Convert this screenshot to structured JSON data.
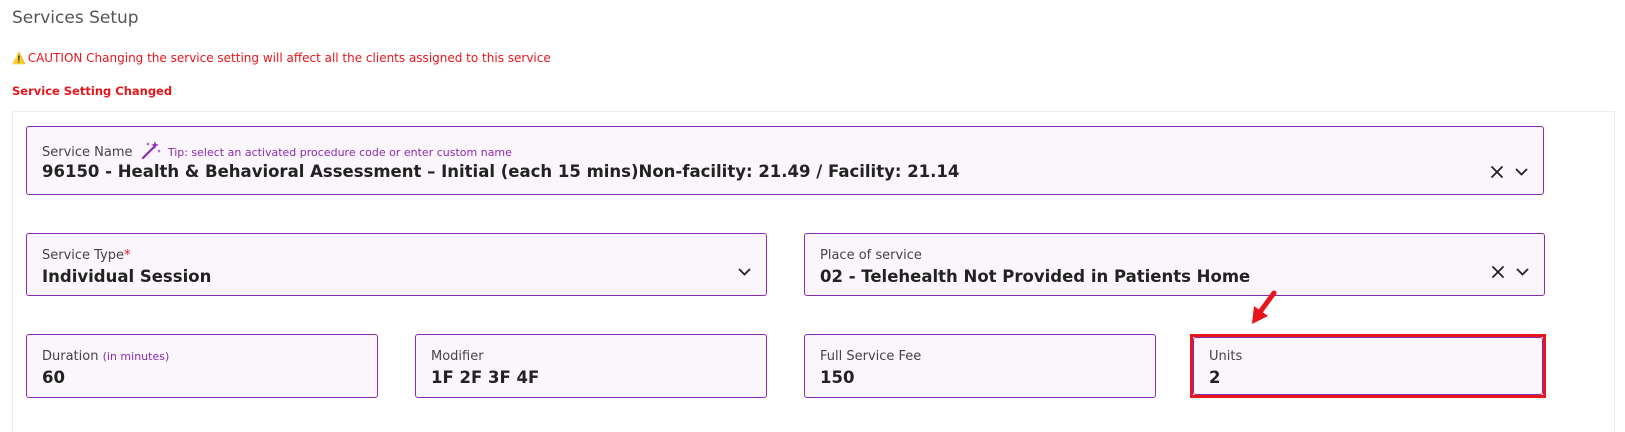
{
  "page": {
    "title": "Services Setup",
    "caution_text": "CAUTION Changing the service setting will affect all the clients assigned to this service",
    "changed_text": "Service Setting Changed"
  },
  "service_name": {
    "label": "Service Name",
    "tip": "Tip: select an activated procedure code or enter custom name",
    "value": "96150 - Health & Behavioral Assessment – Initial (each 15 mins)Non-facility: 21.49 / Facility: 21.14"
  },
  "service_type": {
    "label": "Service Type",
    "required_mark": "*",
    "value": "Individual Session"
  },
  "place_of_service": {
    "label": "Place of service",
    "value": "02 - Telehealth Not Provided in Patients Home"
  },
  "duration": {
    "label": "Duration",
    "hint": "(in minutes)",
    "value": "60"
  },
  "modifier": {
    "label": "Modifier",
    "value": "1F 2F 3F 4F"
  },
  "fee": {
    "label": "Full Service Fee",
    "value": "150"
  },
  "units": {
    "label": "Units",
    "value": "2"
  },
  "colors": {
    "accent": "#8b2bb3",
    "danger": "#e8161b",
    "field_bg": "#faf6fb"
  },
  "icons": {
    "warning": "warning-icon",
    "wand": "magic-wand-icon",
    "clear": "close-icon",
    "dropdown": "chevron-down-icon",
    "annotation": "red-arrow-annotation"
  }
}
